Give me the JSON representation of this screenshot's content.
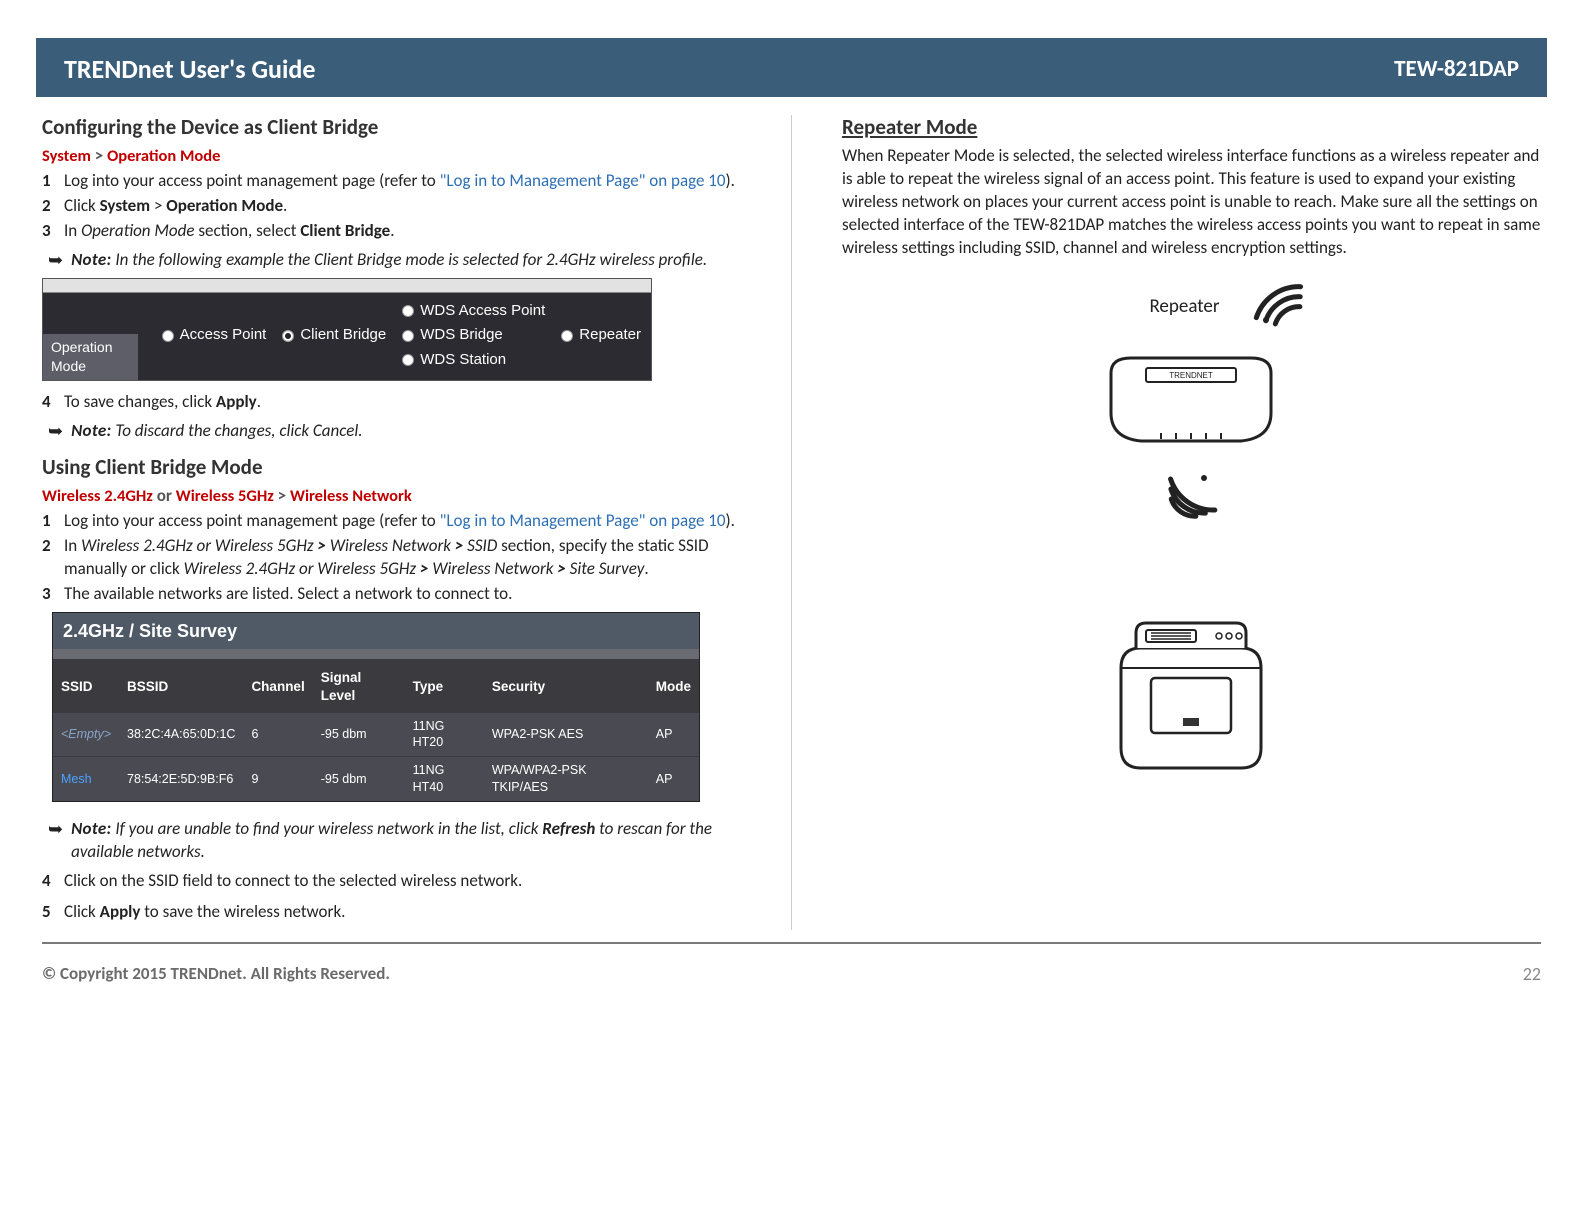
{
  "banner": {
    "left": "TRENDnet User's Guide",
    "right": "TEW-821DAP"
  },
  "left": {
    "h1": "Configuring the Device as Client Bridge",
    "path1_a": "System",
    "path1_sep": " > ",
    "path1_b": "Operation Mode",
    "s1_a": "Log into your access point management page (refer to ",
    "s1_link": "\"Log in to Management Page\" on page 10",
    "s1_b": ").",
    "s2_a": "Click ",
    "s2_b": "System",
    "s2_c": " > ",
    "s2_d": "Operation Mode",
    "s2_e": ".",
    "s3_a": "In ",
    "s3_b": "Operation Mode",
    "s3_c": " section, select ",
    "s3_d": "Client Bridge",
    "s3_e": ".",
    "note1_pref": "Note:",
    "note1": " In the following example the Client Bridge mode is selected for 2.4GHz wireless profile.",
    "op": {
      "label": "Operation Mode",
      "r1": "Access Point",
      "r2": "Client Bridge",
      "r3": "WDS Access Point",
      "r4": "Repeater",
      "r5": "WDS Bridge",
      "r6": "WDS Station"
    },
    "s4_a": "To save changes, click ",
    "s4_b": "Apply",
    "s4_c": ".",
    "note2_pref": "Note:",
    "note2": " To discard the changes, click Cancel.",
    "h2": "Using Client Bridge Mode",
    "p2_a": "Wireless 2.4GHz",
    "p2_b": " or ",
    "p2_c": "Wireless 5GHz",
    "p2_d": " > ",
    "p2_e": "Wireless Network",
    "u1_a": "Log into your access point management page (refer to ",
    "u1_link": "\"Log in to Management Page\" on page 10",
    "u1_b": ").",
    "u2_a": "In ",
    "u2_b": "Wireless 2.4GHz or Wireless 5GHz ",
    "u2_gt1": "> ",
    "u2_c": "Wireless Network ",
    "u2_gt2": "> ",
    "u2_d": "SSID",
    "u2_e": " section, specify the static SSID manually or click ",
    "u2_f": "Wireless 2.4GHz or Wireless 5GHz ",
    "u2_gt3": "> ",
    "u2_g": "Wireless Network ",
    "u2_gt4": "> ",
    "u2_h": "Site Survey",
    "u2_i": ".",
    "u3": "The available networks are listed. Select a network to connect to.",
    "ss": {
      "title": "2.4GHz / Site Survey",
      "head": {
        "ssid": "SSID",
        "bssid": "BSSID",
        "ch": "Channel",
        "sig": "Signal Level",
        "type": "Type",
        "sec": "Security",
        "mode": "Mode"
      },
      "rows": [
        {
          "ssid": "<Empty>",
          "bssid": "38:2C:4A:65:0D:1C",
          "ch": "6",
          "sig": "-95 dbm",
          "type": "11NG HT20",
          "sec": "WPA2-PSK AES",
          "mode": "AP"
        },
        {
          "ssid": "Mesh",
          "bssid": "78:54:2E:5D:9B:F6",
          "ch": "9",
          "sig": "-95 dbm",
          "type": "11NG HT40",
          "sec": "WPA/WPA2-PSK TKIP/AES",
          "mode": "AP"
        }
      ]
    },
    "note3_pref": "Note:",
    "note3_a": " If you are unable to find your wireless network in the list, click ",
    "note3_b": "Refresh",
    "note3_c": " to rescan for the available networks.",
    "u4": "Click on the SSID field to connect to the selected wireless network.",
    "u5_a": "Click ",
    "u5_b": "Apply",
    "u5_c": " to save the wireless network."
  },
  "right": {
    "h1": "Repeater Mode",
    "para": "When Repeater Mode is selected, the selected wireless interface functions as a wireless repeater and is able to repeat the wireless signal of an access point. This feature is used to expand your existing wireless network on places your current access point is unable to reach. Make sure all the settings on selected interface of the TEW-821DAP matches the wireless access points you want to repeat in same wireless settings including SSID, channel and wireless encryption settings.",
    "diag_label": "Repeater"
  },
  "footer": {
    "copyright": "© Copyright 2015 TRENDnet. All Rights Reserved.",
    "page": "22"
  }
}
